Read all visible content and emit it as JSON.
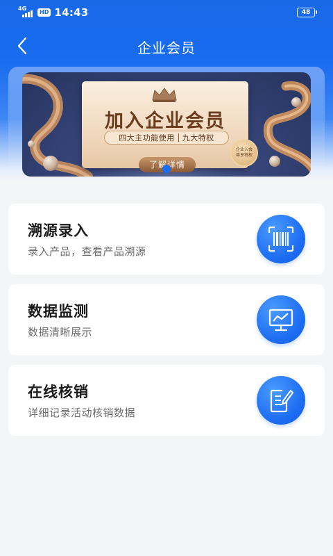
{
  "status_bar": {
    "network": "4G",
    "hd": "HD",
    "time": "14:43",
    "battery": "48"
  },
  "nav": {
    "title": "企业会员"
  },
  "banner": {
    "title": "加入企业会员",
    "sub_left": "四大主功能使用",
    "sub_right": "九大特权",
    "button": "了解详情",
    "medal_line1": "企业入会",
    "medal_line2": "尊享特权"
  },
  "cards": [
    {
      "title": "溯源录入",
      "subtitle": "录入产品，查看产品溯源",
      "icon": "barcode-scan-icon"
    },
    {
      "title": "数据监测",
      "subtitle": "数据清晰展示",
      "icon": "monitor-chart-icon"
    },
    {
      "title": "在线核销",
      "subtitle": "详细记录活动核销数据",
      "icon": "edit-note-icon"
    }
  ],
  "colors": {
    "primary": "#1a6cf0",
    "page_bg": "#f4f5f7",
    "card_bg": "#ffffff"
  }
}
